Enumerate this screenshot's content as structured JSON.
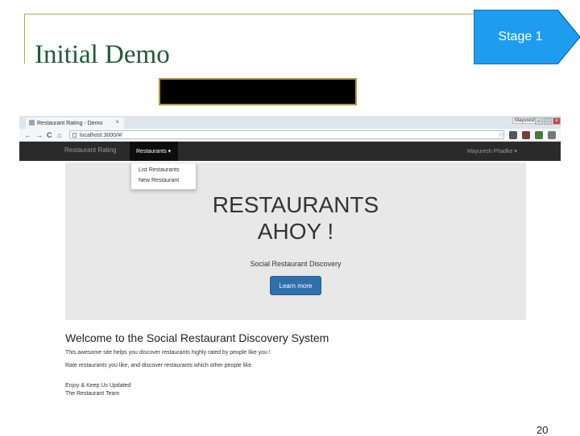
{
  "slide": {
    "title": "Initial Demo",
    "stage_label": "Stage 1",
    "page_number": "20"
  },
  "colors": {
    "stage_fill": "#1e9cf0",
    "frame": "#b8a64a",
    "appbar": "#2a2a2a",
    "primary_button": "#2f6fab"
  },
  "browser": {
    "tab_title": "Restaurant Rating - Demo",
    "tab_close": "×",
    "url": "localhost:3000/#/",
    "profile": "Mayuresh",
    "nav_icons": [
      "back-icon",
      "forward-icon",
      "reload-icon",
      "home-icon"
    ],
    "glyphs": {
      "back": "←",
      "forward": "→",
      "reload": "C",
      "home": "⌂",
      "star": "☆",
      "minimize": "–",
      "maximize": "□",
      "close": "×"
    }
  },
  "app": {
    "brand": "Restaurant Rating",
    "menu_active": "Restaurants ▾",
    "user": "Mayuresh Phadke ▾",
    "dropdown": [
      "List Restaurants",
      "New Restaurant"
    ],
    "hero_title_line1": "RESTAURANTS",
    "hero_title_line2": "AHOY !",
    "hero_subtitle": "Social Restaurant Discovery",
    "learn_more": "Learn more",
    "welcome": "Welcome to the Social Restaurant Discovery System",
    "paragraphs": [
      "This awesome site helps you discover restaurants highly rated by people like you !",
      "Rate restaurants you like, and discover restaurants which other people like.",
      "Enjoy & Keep Us Updated",
      "The Restaurant Team"
    ]
  }
}
